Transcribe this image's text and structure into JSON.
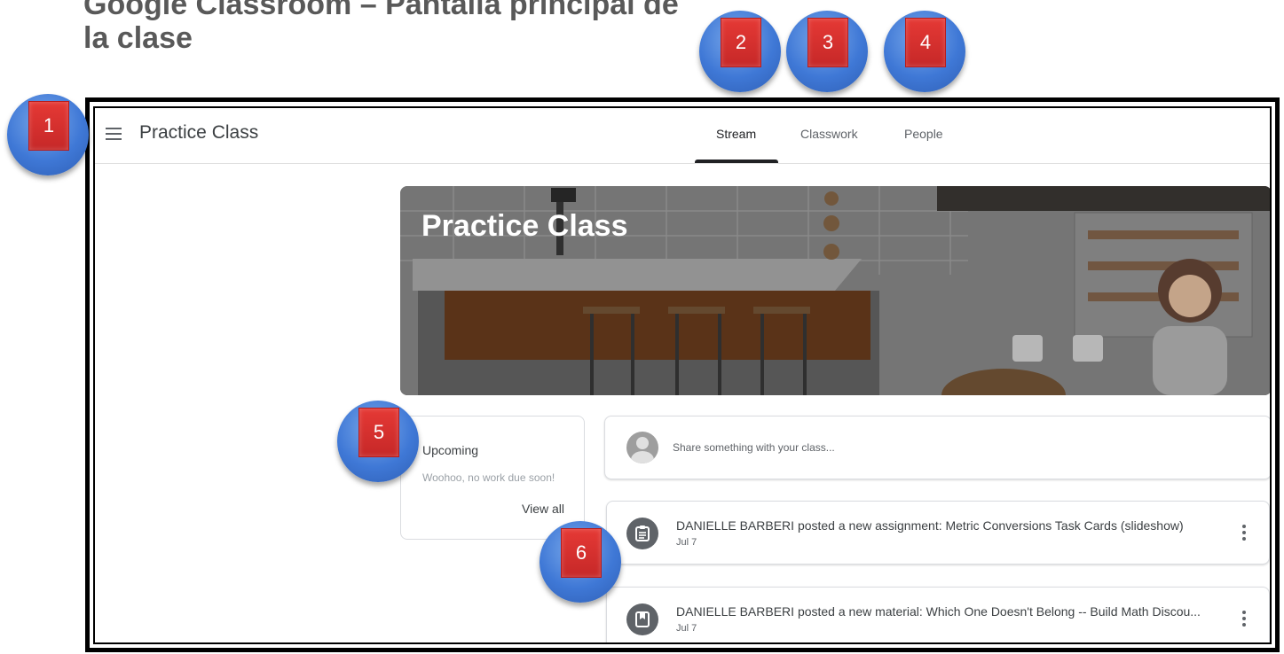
{
  "slide": {
    "title": "Google Classroom – Pantalla principal de la clase"
  },
  "topbar": {
    "class_name": "Practice Class",
    "tabs": [
      {
        "label": "Stream",
        "active": true
      },
      {
        "label": "Classwork",
        "active": false
      },
      {
        "label": "People",
        "active": false
      }
    ]
  },
  "banner": {
    "title": "Practice Class"
  },
  "upcoming": {
    "title": "Upcoming",
    "empty_text": "Woohoo, no work due soon!",
    "view_all": "View all"
  },
  "share": {
    "placeholder": "Share something with your class..."
  },
  "posts": [
    {
      "text": "DANIELLE BARBERI posted a new assignment: Metric Conversions Task Cards (slideshow)",
      "date": "Jul 7",
      "icon": "assignment-icon"
    },
    {
      "text": "DANIELLE BARBERI posted a new material: Which One Doesn't Belong -- Build Math Discou...",
      "date": "Jul 7",
      "icon": "material-icon"
    }
  ],
  "callouts": [
    "1",
    "2",
    "3",
    "4",
    "5",
    "6"
  ],
  "colors": {
    "callout_blue": "#3f78d6",
    "callout_red": "#c62828",
    "frame": "#000000"
  }
}
